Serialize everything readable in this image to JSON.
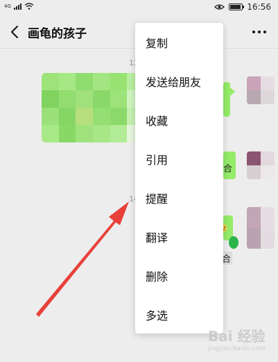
{
  "status_bar": {
    "signal_label": "4G",
    "time": "16:56",
    "icons": [
      "signal-icon",
      "wifi-icon",
      "eye-icon",
      "battery-icon"
    ]
  },
  "header": {
    "title": "画龟的孩子",
    "back_icon": "chevron-left-icon",
    "more_icon": "more-dots-icon"
  },
  "chat": {
    "timestamp_1": "12",
    "timestamp_2": "14",
    "bubble_glyph_1": "合",
    "bubble_glyph_2": "合"
  },
  "context_menu": {
    "items": [
      {
        "label": "复制"
      },
      {
        "label": "发送给朋友"
      },
      {
        "label": "收藏"
      },
      {
        "label": "引用"
      },
      {
        "label": "提醒"
      },
      {
        "label": "翻译"
      },
      {
        "label": "删除"
      },
      {
        "label": "多选"
      }
    ]
  },
  "watermark": {
    "text": "Bai 经验",
    "sub": "jingyan.baidu.com"
  },
  "colors": {
    "bubble_green": "#95ec69",
    "background": "#ededed",
    "arrow_red": "#e8403a"
  }
}
